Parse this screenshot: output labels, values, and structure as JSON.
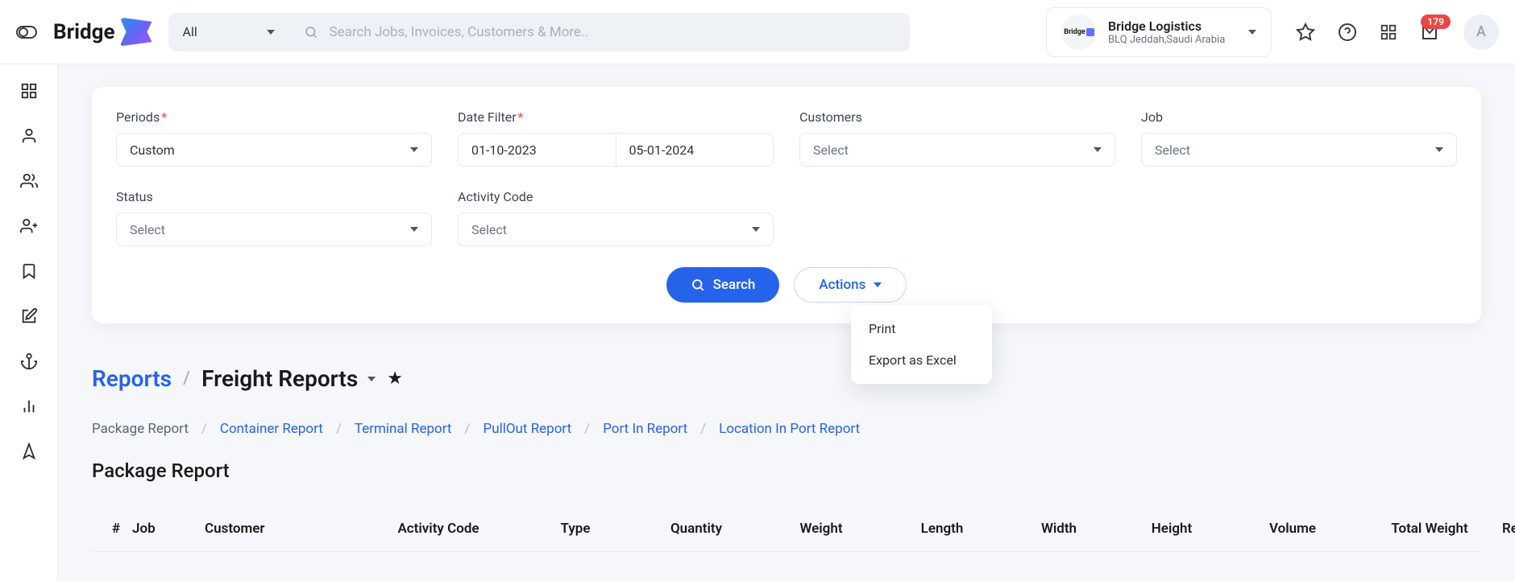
{
  "header": {
    "brand": "Bridge",
    "search_scope": "All",
    "search_placeholder": "Search Jobs, Invoices, Customers & More..",
    "org_name": "Bridge Logistics",
    "org_location": "BLQ Jeddah,Saudi Arabia",
    "inbox_badge": "179",
    "avatar_initial": "A"
  },
  "filters": {
    "periods_label": "Periods",
    "periods_value": "Custom",
    "date_filter_label": "Date Filter",
    "date_from": "01-10-2023",
    "date_to": "05-01-2024",
    "customers_label": "Customers",
    "customers_value": "Select",
    "job_label": "Job",
    "job_value": "Select",
    "status_label": "Status",
    "status_value": "Select",
    "activity_code_label": "Activity Code",
    "activity_code_value": "Select"
  },
  "buttons": {
    "search": "Search",
    "actions": "Actions"
  },
  "actions_menu": {
    "print": "Print",
    "export_excel": "Export as Excel"
  },
  "breadcrumb": {
    "root": "Reports",
    "current": "Freight Reports"
  },
  "tabs": {
    "package_report": "Package Report",
    "container_report": "Container Report",
    "terminal_report": "Terminal Report",
    "pullout_report": "PullOut Report",
    "port_in_report": "Port In Report",
    "location_in_port_report": "Location In Port Report"
  },
  "section_title": "Package Report",
  "table": {
    "cols": {
      "hash": "#",
      "job": "Job",
      "customer": "Customer",
      "activity_code": "Activity Code",
      "type": "Type",
      "quantity": "Quantity",
      "weight": "Weight",
      "length": "Length",
      "width": "Width",
      "height": "Height",
      "volume": "Volume",
      "total_weight": "Total Weight",
      "remarks": "Remarks"
    }
  }
}
